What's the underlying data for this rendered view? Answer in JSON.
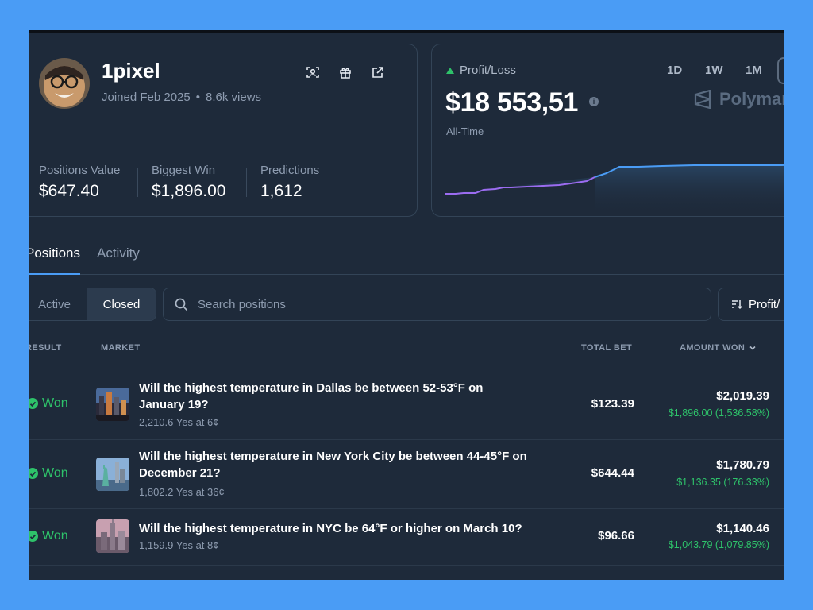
{
  "profile": {
    "username": "1pixel",
    "joined": "Joined Feb 2025",
    "views": "8.6k views",
    "stats": [
      {
        "label": "Positions Value",
        "value": "$647.40"
      },
      {
        "label": "Biggest Win",
        "value": "$1,896.00"
      },
      {
        "label": "Predictions",
        "value": "1,612"
      }
    ]
  },
  "pnl": {
    "title": "Profit/Loss",
    "value": "$18 553,51",
    "period": "All-Time",
    "timeframes": [
      "1D",
      "1W",
      "1M"
    ],
    "brand": "Polymar",
    "colors": {
      "up": "#2ec26a",
      "early_line": "#9b6cf0",
      "line": "#4a9cf5"
    }
  },
  "tabs": {
    "positions": "Positions",
    "activity": "Activity"
  },
  "filters": {
    "active": "Active",
    "closed": "Closed",
    "search_placeholder": "Search positions",
    "sort_label": "Profit/"
  },
  "table": {
    "headers": {
      "result": "RESULT",
      "market": "MARKET",
      "total_bet": "TOTAL BET",
      "amount_won": "AMOUNT WON"
    },
    "rows": [
      {
        "result": "Won",
        "question": "Will the highest temperature in Dallas be between 52-53°F on January 19?",
        "shares": "2,210.6 Yes at 6¢",
        "total_bet": "$123.39",
        "amount_won": "$2,019.39",
        "gain": "$1,896.00 (1,536.58%)"
      },
      {
        "result": "Won",
        "question": "Will the highest temperature in New York City be between 44-45°F on December 21?",
        "shares": "1,802.2 Yes at 36¢",
        "total_bet": "$644.44",
        "amount_won": "$1,780.79",
        "gain": "$1,136.35 (176.33%)"
      },
      {
        "result": "Won",
        "question": "Will the highest temperature in NYC be 64°F or higher on March 10?",
        "shares": "1,159.9 Yes at 8¢",
        "total_bet": "$96.66",
        "amount_won": "$1,140.46",
        "gain": "$1,043.79 (1,079.85%)"
      }
    ]
  }
}
